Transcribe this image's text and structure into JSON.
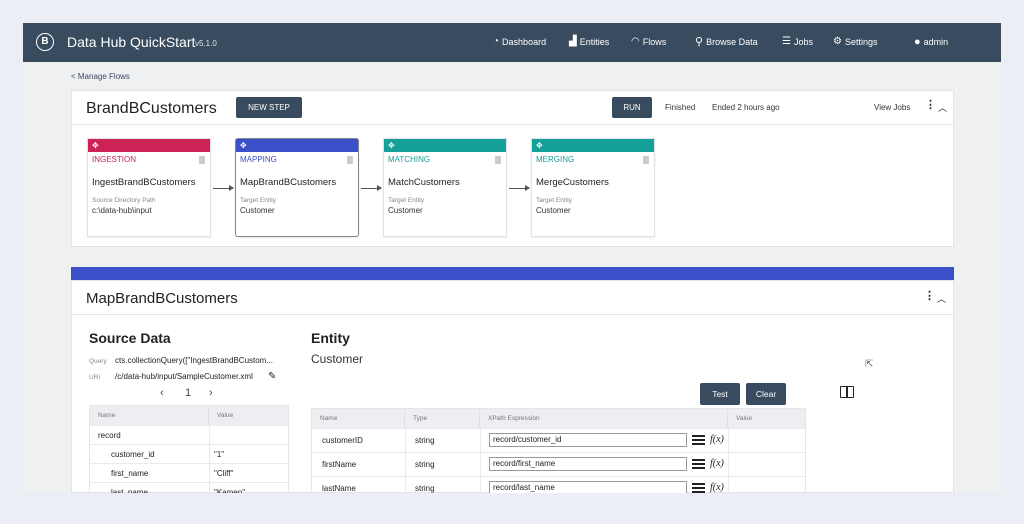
{
  "app": {
    "title": "Data Hub QuickStart",
    "version": "v5.1.0"
  },
  "nav": {
    "dashboard": "Dashboard",
    "entities": "Entities",
    "flows": "Flows",
    "browse": "Browse Data",
    "jobs": "Jobs",
    "settings": "Settings",
    "user": "admin"
  },
  "back_link": "< Manage Flows",
  "flow": {
    "name": "BrandBCustomers",
    "new_step": "NEW STEP",
    "run": "RUN",
    "status": "Finished",
    "ended": "Ended 2 hours ago",
    "view_jobs": "View Jobs"
  },
  "steps": [
    {
      "type": "INGESTION",
      "name": "IngestBrandBCustomers",
      "sub_label": "Source Directory Path",
      "sub_value": "c:\\data-hub\\input",
      "color": "#cc2256"
    },
    {
      "type": "MAPPING",
      "name": "MapBrandBCustomers",
      "sub_label": "Target Entity",
      "sub_value": "Customer",
      "color": "#3b4fc8"
    },
    {
      "type": "MATCHING",
      "name": "MatchCustomers",
      "sub_label": "Target Entity",
      "sub_value": "Customer",
      "color": "#16a09a"
    },
    {
      "type": "MERGING",
      "name": "MergeCustomers",
      "sub_label": "Target Entity",
      "sub_value": "Customer",
      "color": "#16a09a"
    }
  ],
  "mapping": {
    "name": "MapBrandBCustomers",
    "source_title": "Source Data",
    "query_label": "Query",
    "query_value": "cts.collectionQuery([\"IngestBrandBCustom...",
    "uri_label": "URI",
    "uri_value": "/c/data-hub/input/SampleCustomer.xml",
    "page": "1",
    "entity_title": "Entity",
    "entity_name": "Customer",
    "test": "Test",
    "clear": "Clear",
    "source_headers": [
      "Name",
      "Value"
    ],
    "source_rows": [
      {
        "name": "record",
        "value": ""
      },
      {
        "name": "customer_id",
        "value": "\"1\""
      },
      {
        "name": "first_name",
        "value": "\"Cliff\""
      },
      {
        "name": "last_name",
        "value": "\"Kamen\""
      }
    ],
    "entity_headers": [
      "Name",
      "Type",
      "XPath Expression",
      "Value"
    ],
    "entity_rows": [
      {
        "name": "customerID",
        "type": "string",
        "xpath": "record/customer_id"
      },
      {
        "name": "firstName",
        "type": "string",
        "xpath": "record/first_name"
      },
      {
        "name": "lastName",
        "type": "string",
        "xpath": "record/last_name"
      }
    ],
    "fx": "f(x)"
  }
}
